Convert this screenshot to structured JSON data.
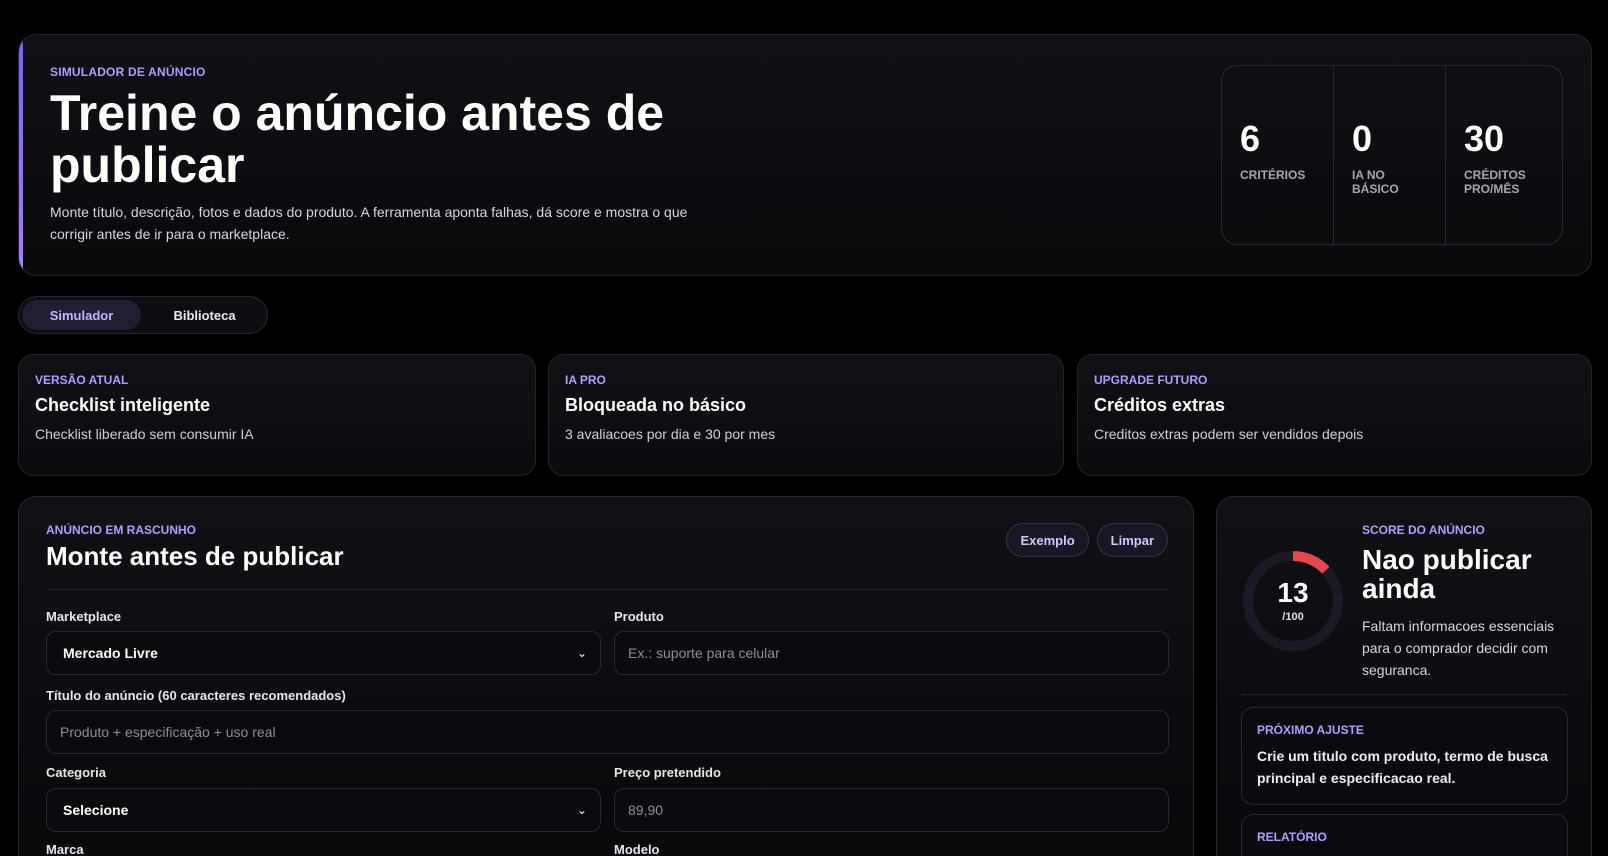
{
  "hero": {
    "kicker": "SIMULADOR DE ANÚNCIO",
    "title": "Treine o anúncio antes de publicar",
    "description": "Monte título, descrição, fotos e dados do produto. A ferramenta aponta falhas, dá score e mostra o que corrigir antes de ir para o marketplace.",
    "stats": [
      {
        "value": "6",
        "label": "CRITÉRIOS"
      },
      {
        "value": "0",
        "label": "IA NO BÁSICO"
      },
      {
        "value": "30",
        "label": "CRÉDITOS PRO/MÊS"
      }
    ]
  },
  "tabs": [
    {
      "label": "Simulador",
      "active": true
    },
    {
      "label": "Biblioteca",
      "active": false
    }
  ],
  "cards": [
    {
      "kicker": "VERSÃO ATUAL",
      "title": "Checklist inteligente",
      "subtitle": "Checklist liberado sem consumir IA"
    },
    {
      "kicker": "IA PRO",
      "title": "Bloqueada no básico",
      "subtitle": "3 avaliacoes por dia e 30 por mes"
    },
    {
      "kicker": "UPGRADE FUTURO",
      "title": "Créditos extras",
      "subtitle": "Creditos extras podem ser vendidos depois"
    }
  ],
  "editor": {
    "kicker": "ANÚNCIO EM RASCUNHO",
    "title": "Monte antes de publicar",
    "example_label": "Exemplo",
    "clear_label": "Limpar",
    "marketplace": {
      "label": "Marketplace",
      "value": "Mercado Livre"
    },
    "product": {
      "label": "Produto",
      "placeholder": "Ex.: suporte para celular"
    },
    "ad_title": {
      "label": "Título do anúncio (60 caracteres recomendados)",
      "placeholder": "Produto + especificação + uso real"
    },
    "category": {
      "label": "Categoria",
      "value": "Selecione"
    },
    "price": {
      "label": "Preço pretendido",
      "placeholder": "89,90"
    },
    "brand": {
      "label": "Marca"
    },
    "model": {
      "label": "Modelo"
    }
  },
  "score": {
    "kicker": "SCORE DO ANÚNCIO",
    "value": "13",
    "max": "/100",
    "fraction": 0.13,
    "verdict": "Nao publicar ainda",
    "description": "Faltam informacoes essenciais para o comprador decidir com seguranca.",
    "next_kicker": "PRÓXIMO AJUSTE",
    "next_text": "Crie um titulo com produto, termo de busca principal e especificacao real.",
    "report_kicker": "RELATÓRIO",
    "ring_color": "#e5484d",
    "track_color": "#1c1a24"
  }
}
